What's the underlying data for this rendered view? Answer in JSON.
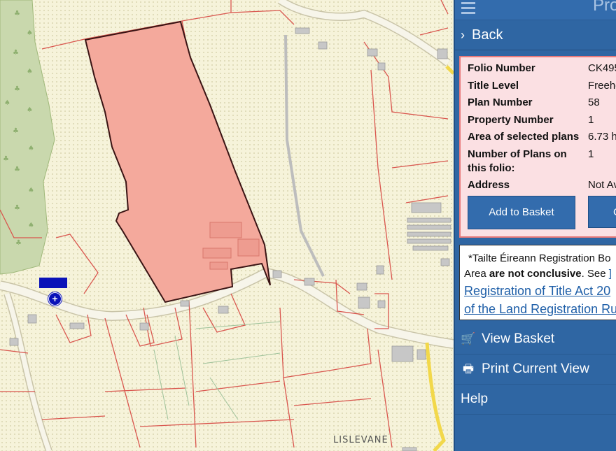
{
  "map": {
    "place_label": "LISLEVANE"
  },
  "panel": {
    "title_fragment": "Pro",
    "back_label": "Back",
    "info": [
      {
        "key": "Folio Number",
        "value": "CK495"
      },
      {
        "key": "Title Level",
        "value": "Freeho"
      },
      {
        "key": "Plan Number",
        "value": "58"
      },
      {
        "key": "Property Number",
        "value": "1"
      },
      {
        "key": "Area of selected plans",
        "value": "6.73 he"
      },
      {
        "key": "Number of Plans on this folio:",
        "value": "1"
      },
      {
        "key": "Address",
        "value": "Not Av"
      }
    ],
    "add_to_basket": "Add to Basket",
    "second_button": "C",
    "notice": {
      "line1": "*Tailte Éireann Registration Bo",
      "line2_pre": "Area ",
      "line2_bold": "are not conclusive",
      "line2_post": ". See ",
      "line2_trail": "]",
      "link1": "Registration of Title Act 20",
      "link2": "of the Land Registration Ru"
    },
    "menu": [
      {
        "label": "View Basket",
        "icon": "cart-icon",
        "glyph": "🛒"
      },
      {
        "label": "Print Current View",
        "icon": "printer-icon",
        "glyph": "🖶"
      },
      {
        "label": "Help",
        "icon": "",
        "glyph": ""
      }
    ]
  },
  "colors": {
    "panel_bg": "#2f66a3",
    "selected_parcel": "#f4a99c",
    "parcel_line": "#d9564e",
    "info_bg": "#fbe0e3",
    "marker": "#0a12b8"
  }
}
